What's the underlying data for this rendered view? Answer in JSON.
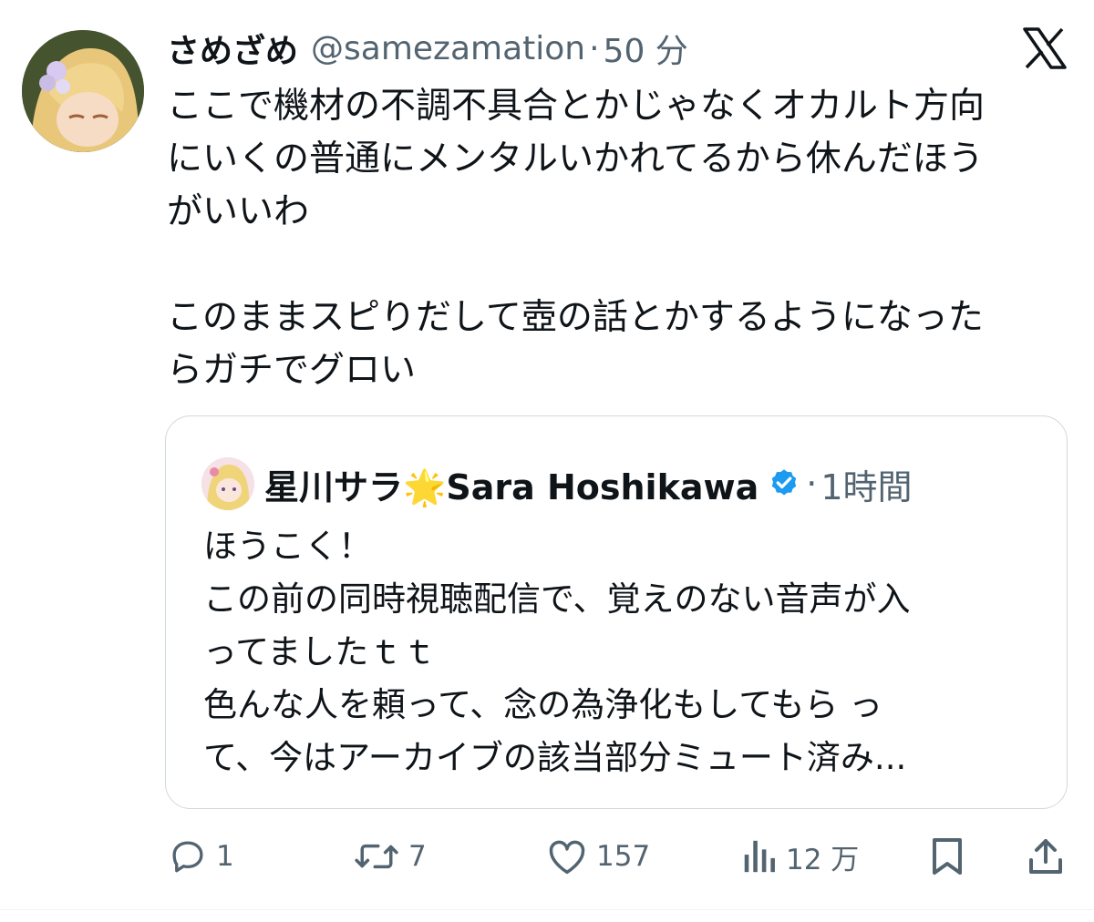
{
  "tweet": {
    "display_name": "さめざめ",
    "handle": "@samezamation",
    "separator": "·",
    "time": "50 分",
    "paragraphs": [
      [
        "ここで機材の不調不具合とかじゃなくオカルト方向",
        "にいくの普通にメンタルいかれてるから休んだほう",
        "がいいわ"
      ],
      [
        "このままスピりだして壺の話とかするようになった",
        "らガチでグロい"
      ]
    ]
  },
  "quote": {
    "display_name": "星川サラ",
    "emoji": "🌟",
    "display_name_en": "Sara Hoshikawa",
    "separator": "·",
    "time": "1時間",
    "lines": [
      "ほうこく！",
      "この前の同時視聴配信で、覚えのない音声が入",
      "ってましたｔｔ",
      "色んな人を頼って、念の為浄化もしてもら っ",
      "て、今はアーカイブの該当部分ミュート済み..."
    ]
  },
  "actions": {
    "replies": "1",
    "retweets": "7",
    "likes": "157",
    "views": "12 万"
  },
  "icons": {
    "x_logo": "x-logo-icon",
    "verified": "verified-badge-icon",
    "reply": "reply-icon",
    "retweet": "retweet-icon",
    "like": "heart-icon",
    "views": "views-chart-icon",
    "bookmark": "bookmark-icon",
    "share": "share-icon"
  },
  "colors": {
    "text": "#0f1419",
    "secondary": "#536471",
    "verified": "#1d9bf0",
    "border": "#cfd9de"
  }
}
